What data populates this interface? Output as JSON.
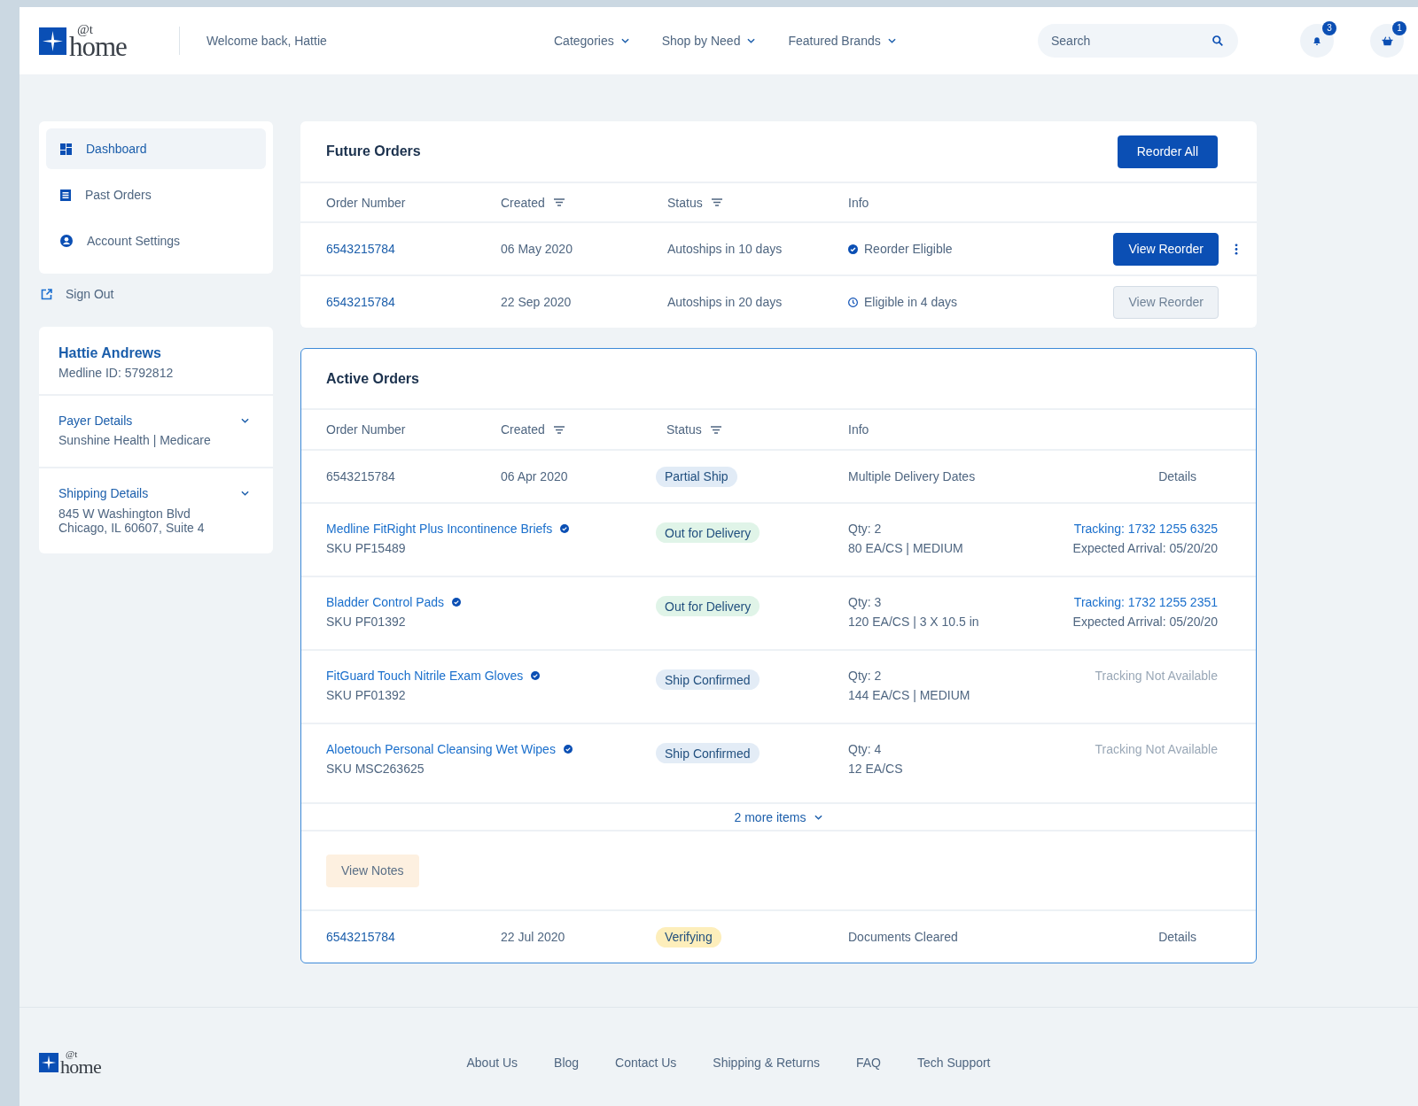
{
  "header": {
    "logo": {
      "at": "@t",
      "word": "home"
    },
    "welcome": "Welcome back, Hattie",
    "nav": [
      {
        "label": "Categories"
      },
      {
        "label": "Shop by Need"
      },
      {
        "label": "Featured Brands"
      }
    ],
    "search": {
      "placeholder": "Search"
    },
    "notifications": {
      "count": "3"
    },
    "cart": {
      "count": "1"
    }
  },
  "sidebar": {
    "items": [
      {
        "label": "Dashboard",
        "selected": true
      },
      {
        "label": "Past Orders",
        "selected": false
      },
      {
        "label": "Account Settings",
        "selected": false
      }
    ],
    "sign_out": "Sign Out"
  },
  "profile": {
    "name": "Hattie Andrews",
    "member_id": "Medline ID: 5792812",
    "sections": [
      {
        "title": "Payer Details",
        "expanded": false,
        "lines": [
          "Sunshine Health | Medicare"
        ]
      },
      {
        "title": "Shipping Details",
        "expanded": false,
        "lines": [
          "845 W Washington Blvd",
          "Chicago, IL 60607, Suite 4"
        ]
      }
    ]
  },
  "future_orders": {
    "title": "Future Orders",
    "action": "Reorder All",
    "columns": [
      {
        "label": "Order Number",
        "filter": false
      },
      {
        "label": "Created",
        "filter": true
      },
      {
        "label": "Status",
        "filter": true
      },
      {
        "label": "Info",
        "filter": false
      }
    ],
    "rows": [
      {
        "number": "6543215784",
        "created": "06 May 2020",
        "status": "Autoships in 10 days",
        "info": {
          "kind": "eligible",
          "text": "Reorder Eligible"
        },
        "button": {
          "label": "View Reorder",
          "disabled": false
        },
        "menu": true
      },
      {
        "number": "6543215784",
        "created": "22 Sep 2020",
        "status": "Autoships in 20 days",
        "info": {
          "kind": "pending",
          "text": "Eligible in 4 days"
        },
        "button": {
          "label": "View Reorder",
          "disabled": true
        },
        "menu": false
      }
    ]
  },
  "active_orders": {
    "title": "Active Orders",
    "columns": [
      {
        "label": "Order Number",
        "filter": false
      },
      {
        "label": "Created",
        "filter": true
      },
      {
        "label": "Status",
        "filter": true
      },
      {
        "label": "Info",
        "filter": false
      }
    ],
    "orders": [
      {
        "number": "6543215784",
        "created": "06 Apr 2020",
        "status": {
          "label": "Partial Ship",
          "color": "#e1ebf6"
        },
        "info": "Multiple Delivery Dates",
        "details": "Details",
        "expanded": true,
        "items": [
          {
            "name": "Medline FitRight Plus Incontinence Briefs",
            "verified": true,
            "sku": "SKU PF15489",
            "status": {
              "label": "Out for Delivery",
              "color": "#e0f4e8"
            },
            "qty": "Qty: 2",
            "size": "80 EA/CS | MEDIUM",
            "tracking": {
              "text": "Tracking: 1732 1255 6325",
              "available": true
            },
            "arrival": "Expected Arrival: 05/20/20"
          },
          {
            "name": "Bladder Control Pads",
            "verified": true,
            "sku": "SKU PF01392",
            "status": {
              "label": "Out for Delivery",
              "color": "#e0f4e8"
            },
            "qty": "Qty: 3",
            "size": "120 EA/CS | 3 X 10.5 in",
            "tracking": {
              "text": "Tracking: 1732 1255 2351",
              "available": true
            },
            "arrival": "Expected Arrival: 05/20/20"
          },
          {
            "name": "FitGuard Touch Nitrile Exam Gloves",
            "verified": true,
            "sku": "SKU PF01392",
            "status": {
              "label": "Ship Confirmed",
              "color": "#e3ecf6"
            },
            "qty": "Qty: 2",
            "size": "144 EA/CS | MEDIUM",
            "tracking": {
              "text": "Tracking Not Available",
              "available": false
            }
          },
          {
            "name": "Aloetouch Personal Cleansing Wet Wipes",
            "verified": true,
            "sku": "SKU MSC263625",
            "status": {
              "label": "Ship Confirmed",
              "color": "#e3ecf6"
            },
            "qty": "Qty: 4",
            "size": "12 EA/CS",
            "tracking": {
              "text": "Tracking Not Available",
              "available": false
            }
          }
        ],
        "more": "2 more items",
        "notes": "View Notes"
      },
      {
        "number": "6543215784",
        "created": "22 Jul 2020",
        "status": {
          "label": "Verifying",
          "color": "#fdeebb"
        },
        "info": "Documents Cleared",
        "details": "Details",
        "expanded": false
      }
    ]
  },
  "footer": {
    "logo": {
      "at": "@t",
      "word": "home"
    },
    "links": [
      "About Us",
      "Blog",
      "Contact Us",
      "Shipping & Returns",
      "FAQ",
      "Tech Support"
    ]
  }
}
